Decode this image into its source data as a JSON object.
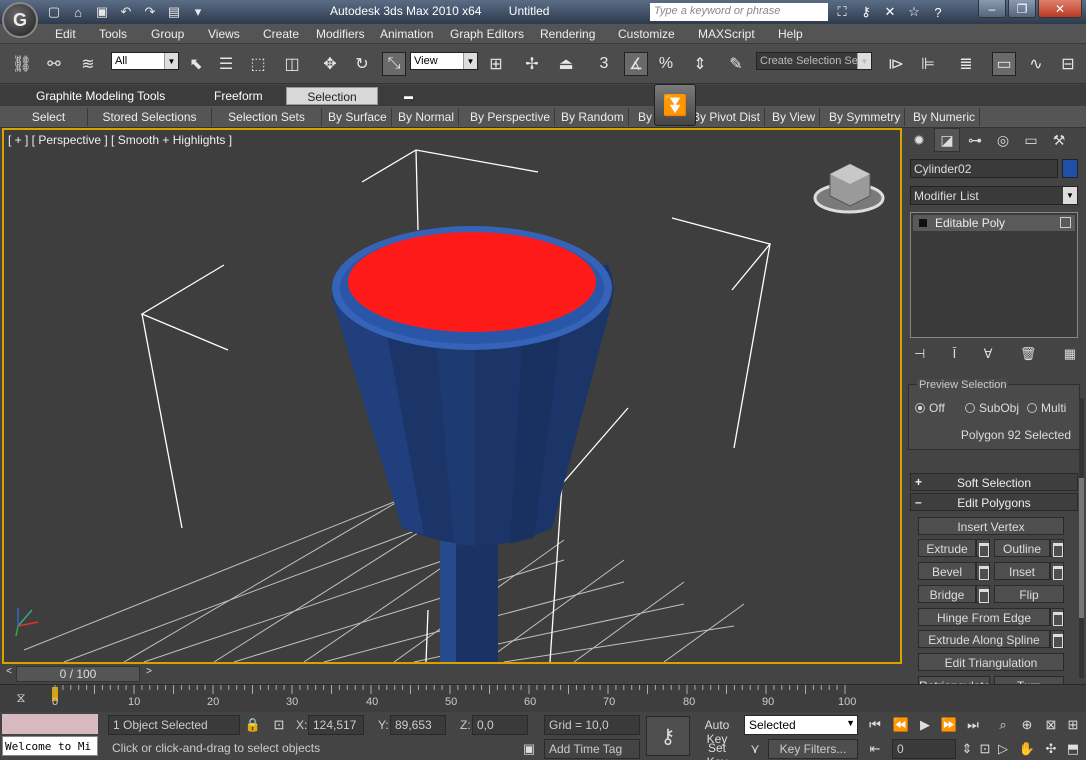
{
  "app": {
    "logo_letter": "G",
    "title": "Autodesk 3ds Max  2010 x64",
    "document": "Untitled",
    "search_placeholder": "Type a keyword or phrase"
  },
  "menu": [
    "Edit",
    "Tools",
    "Group",
    "Views",
    "Create",
    "Modifiers",
    "Animation",
    "Graph Editors",
    "Rendering",
    "Customize",
    "MAXScript",
    "Help"
  ],
  "toolbar": {
    "selection_filter": "All",
    "ref_coord": "View",
    "named_selection_placeholder": "Create Selection Se"
  },
  "ribbon": {
    "tabs": [
      "Graphite Modeling Tools",
      "Freeform",
      "Selection"
    ],
    "active_tab": "Selection",
    "buttons": [
      "Select",
      "Stored Selections",
      "Selection Sets",
      "By Surface",
      "By Normal",
      "By Perspective",
      "By Random",
      "By Half",
      "By Pivot Dist",
      "By View",
      "By Symmetry",
      "By Numeric"
    ]
  },
  "viewport": {
    "label": "[ + ] [ Perspective ] [ Smooth + Highlights ]",
    "selected_color": "#ff1a1a",
    "object_color": "#1f3d7a"
  },
  "command_panel": {
    "object_name": "Cylinder02",
    "object_color": "#1f4fa8",
    "modifier_list": "Modifier List",
    "stack_entry": "Editable Poly",
    "preview_selection": {
      "title": "Preview Selection",
      "options": [
        "Off",
        "SubObj",
        "Multi"
      ],
      "selected": "Off",
      "status": "Polygon 92 Selected"
    },
    "soft_selection": "Soft Selection",
    "edit_polygons": "Edit Polygons",
    "buttons": {
      "insert_vertex": "Insert Vertex",
      "extrude": "Extrude",
      "outline": "Outline",
      "bevel": "Bevel",
      "inset": "Inset",
      "bridge": "Bridge",
      "flip": "Flip",
      "hinge": "Hinge From Edge",
      "extrude_spline": "Extrude Along Spline",
      "edit_tri": "Edit Triangulation",
      "retriangulate": "Retriangulate",
      "turn": "Turn"
    }
  },
  "timeline": {
    "frame": "0 / 100",
    "ticks": [
      "0",
      "10",
      "20",
      "30",
      "40",
      "50",
      "60",
      "70",
      "80",
      "90",
      "100"
    ]
  },
  "status": {
    "welcome": "Welcome to Mi",
    "selected": "1 Object Selected",
    "prompt": "Click or click-and-drag to select objects",
    "x_label": "X:",
    "x": "124,517",
    "y_label": "Y:",
    "y": "89,653",
    "z_label": "Z:",
    "z": "0,0",
    "grid": "Grid = 10,0",
    "add_time_tag": "Add Time Tag",
    "auto_key": "Auto Key",
    "set_key": "Set Key",
    "key_mode": "Selected",
    "key_filters": "Key Filters...",
    "frame_field": "0"
  }
}
